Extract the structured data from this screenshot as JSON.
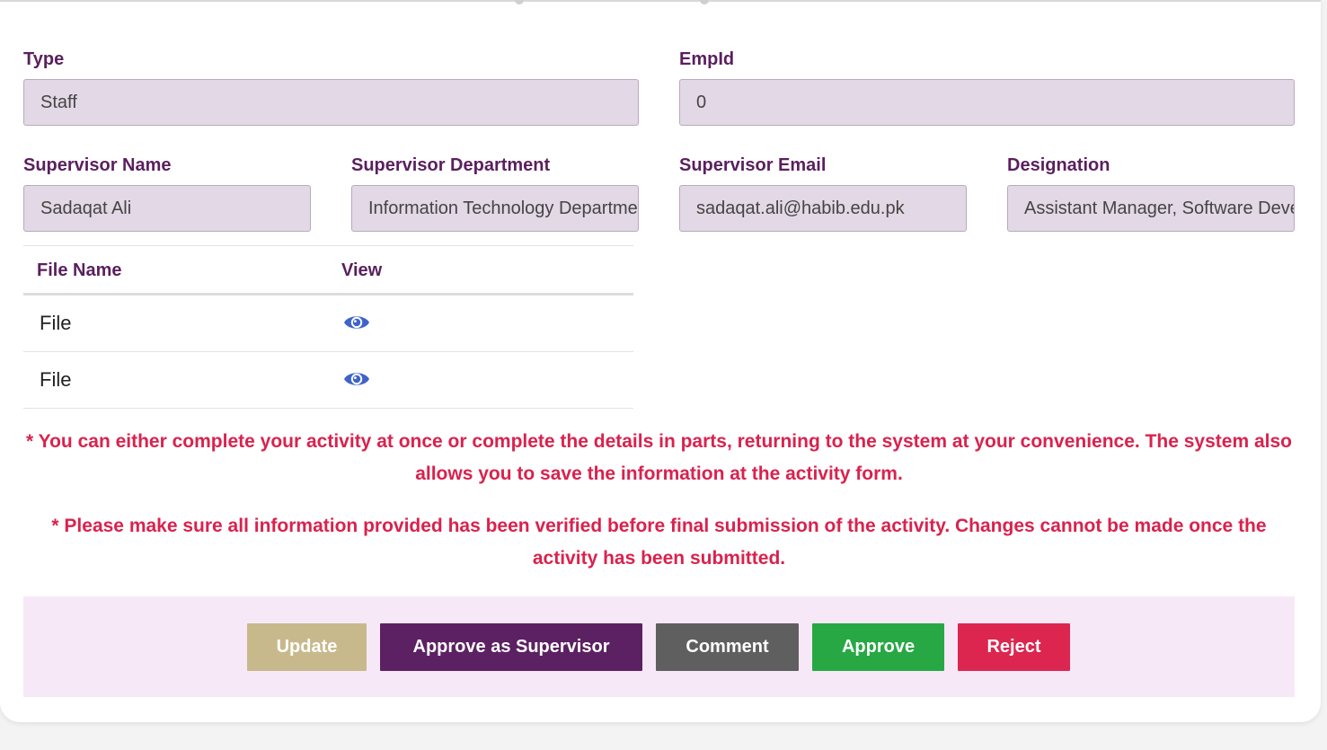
{
  "form": {
    "type": {
      "label": "Type",
      "value": "Staff"
    },
    "empid": {
      "label": "EmpId",
      "value": "0"
    },
    "supervisor_name": {
      "label": "Supervisor Name",
      "value": "Sadaqat Ali"
    },
    "supervisor_department": {
      "label": "Supervisor Department",
      "value": "Information Technology Department"
    },
    "supervisor_email": {
      "label": "Supervisor Email",
      "value": "sadaqat.ali@habib.edu.pk"
    },
    "designation": {
      "label": "Designation",
      "value": "Assistant Manager, Software Development"
    }
  },
  "files": {
    "headers": [
      "File Name",
      "View"
    ],
    "rows": [
      {
        "name": "File",
        "view_icon": "eye-icon"
      },
      {
        "name": "File",
        "view_icon": "eye-icon"
      }
    ]
  },
  "notes": [
    "* You can either complete your activity at once or complete the details in parts, returning to the system at your convenience. The system also allows you to save the information at the activity form.",
    "* Please make sure all information provided has been verified before final submission of the activity. Changes cannot be made once the activity has been submitted."
  ],
  "actions": {
    "update": "Update",
    "approve_as_supervisor": "Approve as Supervisor",
    "comment": "Comment",
    "approve": "Approve",
    "reject": "Reject"
  },
  "colors": {
    "label": "#5a1f5e",
    "input_bg": "#e3d8e6",
    "note": "#d9224e",
    "actions_bg": "#f7e8f8",
    "update": "#c8b98c",
    "approve_as_supervisor": "#5c2162",
    "comment": "#5f5f5f",
    "approve": "#27a844",
    "reject": "#dc2650",
    "eye_icon": "#3f63c9"
  }
}
